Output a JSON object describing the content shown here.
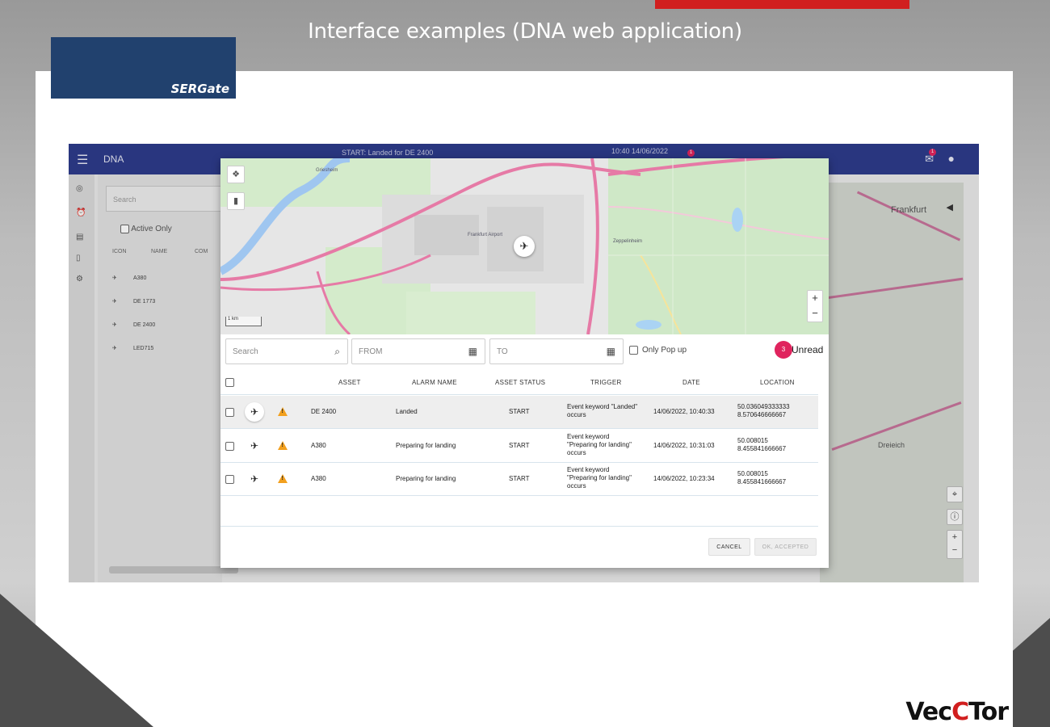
{
  "slide": {
    "title": "Interface examples (DNA web application)",
    "logo_text": "SERGate",
    "brand_left": "Vec",
    "brand_mid": "C",
    "brand_right": "Tor"
  },
  "app": {
    "name": "DNA",
    "topbar_status": "START: Landed for DE 2400",
    "topbar_clock": "10:40 14/06/2022",
    "topbar_badge": "1",
    "mail_badge": "1",
    "left_panel": {
      "search_placeholder": "Search",
      "active_only_label": "Active Only",
      "headers": [
        "ICON",
        "NAME",
        "COM"
      ],
      "rows": [
        "A380",
        "DE 1773",
        "DE 2400",
        "LED715"
      ]
    },
    "bg_map_labels": [
      "Frankfurt",
      "Dreieich"
    ]
  },
  "dialog": {
    "map_labels": [
      "Griesheim",
      "Zeppelinheim",
      "Frankfurt Airport"
    ],
    "zoom_in": "+",
    "zoom_out": "−",
    "scale": "1 km",
    "filters": {
      "search_placeholder": "Search",
      "from_placeholder": "FROM",
      "to_placeholder": "TO",
      "only_popup_label": "Only Pop up",
      "unread_count": "3",
      "unread_label": "Unread"
    },
    "table": {
      "headers": {
        "asset": "ASSET",
        "alarm_name": "ALARM NAME",
        "asset_status": "ASSET STATUS",
        "trigger": "TRIGGER",
        "date": "DATE",
        "location": "LOCATION"
      },
      "rows": [
        {
          "asset": "DE 2400",
          "alarm_name": "Landed",
          "status": "START",
          "trigger_1": "Event keyword \"Landed\"",
          "trigger_2": "occurs",
          "trigger_3": "",
          "date": "14/06/2022, 10:40:33",
          "loc_1": "50.036049333333",
          "loc_2": "8.570646666667"
        },
        {
          "asset": "A380",
          "alarm_name": "Preparing for landing",
          "status": "START",
          "trigger_1": "Event keyword",
          "trigger_2": "\"Preparing for landing\"",
          "trigger_3": "occurs",
          "date": "14/06/2022, 10:31:03",
          "loc_1": "50.008015",
          "loc_2": "8.455841666667"
        },
        {
          "asset": "A380",
          "alarm_name": "Preparing for landing",
          "status": "START",
          "trigger_1": "Event keyword",
          "trigger_2": "\"Preparing for landing\"",
          "trigger_3": "occurs",
          "date": "14/06/2022, 10:23:34",
          "loc_1": "50.008015",
          "loc_2": "8.455841666667"
        }
      ]
    },
    "cancel_label": "CANCEL",
    "ack_label": "OK, ACCEPTED"
  },
  "colors": {
    "topbar": "#2d3b8a",
    "unread_badge": "#e0245e",
    "warning": "#f2a01e",
    "brand_red": "#d11f1f",
    "logo_bg": "#21416e"
  }
}
